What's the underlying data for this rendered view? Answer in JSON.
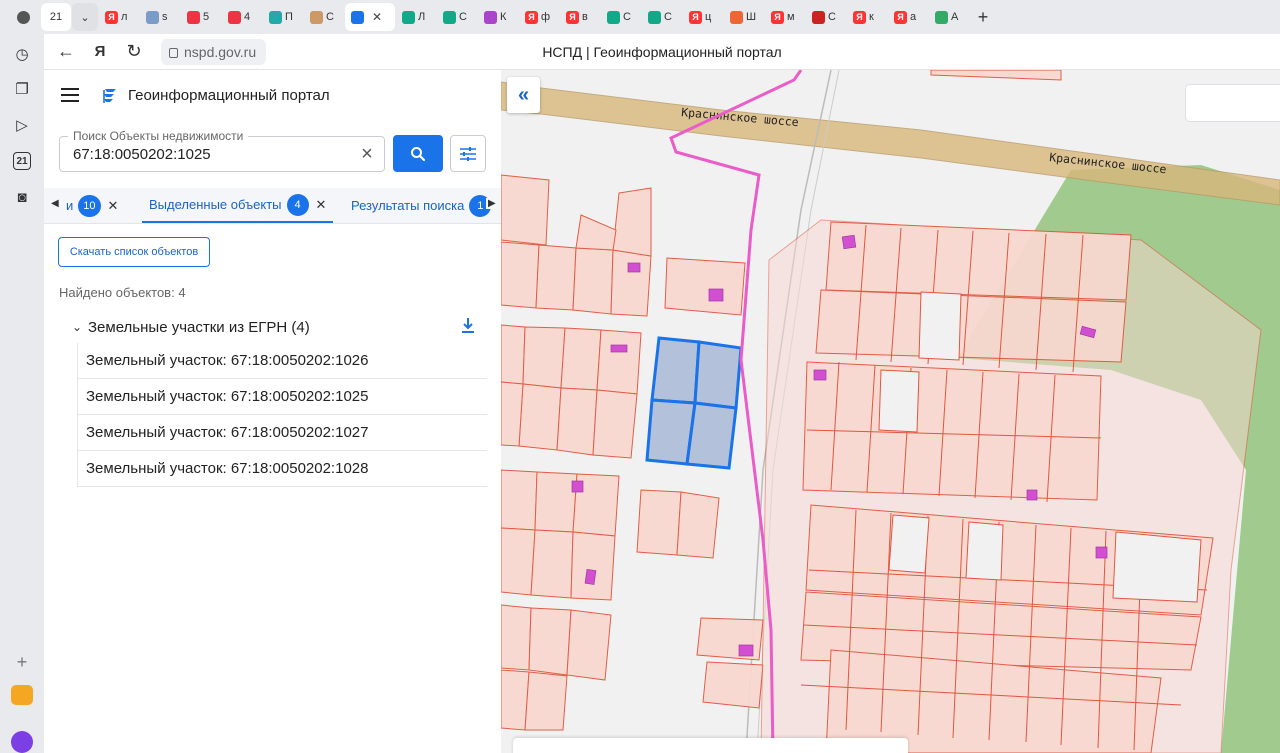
{
  "browser": {
    "tab_counter": "21",
    "tabs": [
      {
        "icon": "yandex-icon",
        "label": "Я",
        "title": "л",
        "color": "#f33"
      },
      {
        "icon": "emblem-icon",
        "label": "",
        "title": "s",
        "color": "#7a9cc6"
      },
      {
        "icon": "mail-icon",
        "label": "",
        "title": "5",
        "color": "#e34"
      },
      {
        "icon": "mail-icon",
        "label": "",
        "title": "4",
        "color": "#e34"
      },
      {
        "icon": "star-icon",
        "label": "",
        "title": "П",
        "color": "#2aa"
      },
      {
        "icon": "cat-icon",
        "label": "",
        "title": "С",
        "color": "#c96"
      },
      {
        "icon": "nspd-icon",
        "label": "",
        "title": "",
        "color": "#1a73e8",
        "active": true
      },
      {
        "icon": "shield-icon",
        "label": "",
        "title": "Л",
        "color": "#1a8"
      },
      {
        "icon": "shield-icon",
        "label": "",
        "title": "С",
        "color": "#1a8"
      },
      {
        "icon": "puzzle-icon",
        "label": "",
        "title": "К",
        "color": "#a4c"
      },
      {
        "icon": "yandex-icon",
        "label": "Я",
        "title": "ф",
        "color": "#f33"
      },
      {
        "icon": "yandex-icon",
        "label": "Я",
        "title": "в",
        "color": "#f33"
      },
      {
        "icon": "shield-icon",
        "label": "",
        "title": "С",
        "color": "#1a8"
      },
      {
        "icon": "shield-icon",
        "label": "",
        "title": "С",
        "color": "#1a8"
      },
      {
        "icon": "yandex-icon",
        "label": "Я",
        "title": "ц",
        "color": "#f33"
      },
      {
        "icon": "heart-icon",
        "label": "",
        "title": "Ш",
        "color": "#e63"
      },
      {
        "icon": "yandex-icon",
        "label": "Я",
        "title": "м",
        "color": "#f33"
      },
      {
        "icon": "mail-icon",
        "label": "",
        "title": "С",
        "color": "#c22"
      },
      {
        "icon": "yandex-icon",
        "label": "Я",
        "title": "к",
        "color": "#f33"
      },
      {
        "icon": "yandex-icon",
        "label": "Я",
        "title": "а",
        "color": "#f33"
      },
      {
        "icon": "apps-icon",
        "label": "",
        "title": "А",
        "color": "#3a6"
      }
    ],
    "url": "nspd.gov.ru",
    "page_title": "НСПД | Геоинформационный портал",
    "rail_badge": "21"
  },
  "app": {
    "title": "Геоинформационный портал",
    "search": {
      "label": "Поиск Объекты недвижимости",
      "value": "67:18:0050202:1025"
    },
    "tabs": [
      {
        "label": "и",
        "count": "10"
      },
      {
        "label": "Выделенные объекты",
        "count": "4",
        "active": true
      },
      {
        "label": "Результаты поиска",
        "count": "1"
      }
    ],
    "download_list_label": "Скачать список объектов",
    "found_label": "Найдено объектов: 4",
    "group_title": "Земельные участки из ЕГРН (4)",
    "results": [
      "Земельный участок: 67:18:0050202:1026",
      "Земельный участок: 67:18:0050202:1025",
      "Земельный участок: 67:18:0050202:1027",
      "Земельный участок: 67:18:0050202:1028"
    ]
  },
  "map": {
    "road_name": "Краснинское шоссе",
    "colors": {
      "parcel_fill": "#f8d8d0",
      "parcel_stroke": "#e2563d",
      "building": "#d14fd0",
      "selected_fill": "#a9b8d6",
      "selected_stroke": "#1a73e8",
      "forest": "#93c47d",
      "road": "#d9b77b",
      "boundary": "#ea5cc7"
    }
  }
}
